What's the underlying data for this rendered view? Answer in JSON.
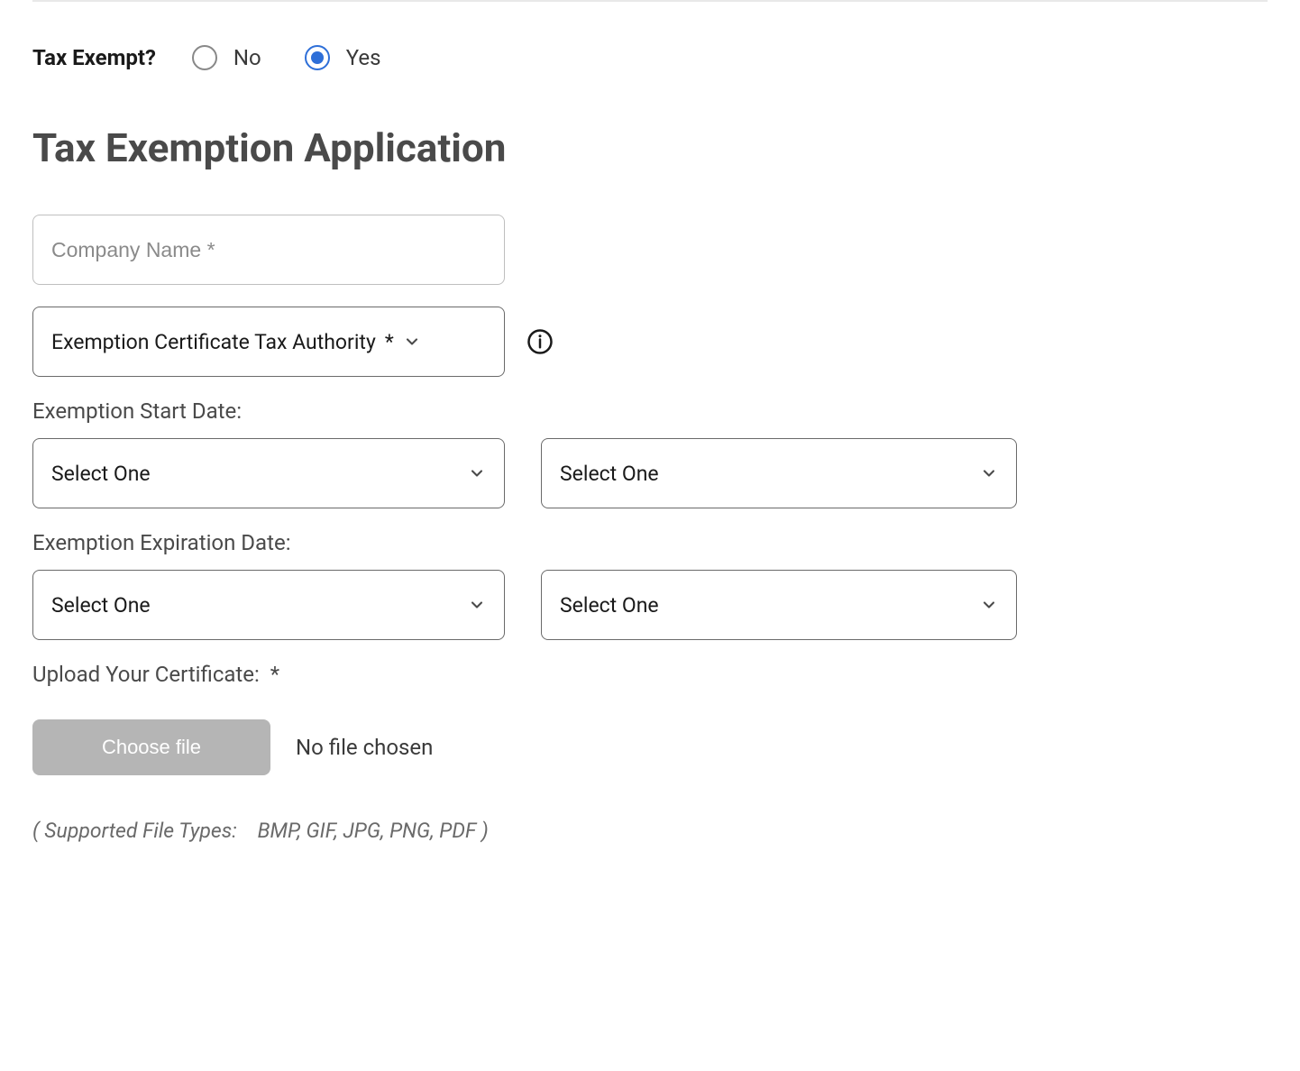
{
  "radio": {
    "question": "Tax Exempt?",
    "no_label": "No",
    "yes_label": "Yes",
    "selected": "yes"
  },
  "title": "Tax Exemption Application",
  "company_name": {
    "placeholder": "Company Name *"
  },
  "tax_authority": {
    "label": "Exemption Certificate Tax Authority",
    "required_marker": "*"
  },
  "start_date": {
    "label": "Exemption Start Date:",
    "select1": "Select One",
    "select2": "Select One"
  },
  "expiration_date": {
    "label": "Exemption Expiration Date:",
    "select1": "Select One",
    "select2": "Select One"
  },
  "upload": {
    "label": "Upload Your Certificate:",
    "required_marker": "*",
    "button": "Choose file",
    "status": "No file chosen"
  },
  "supported_types": "( Supported File Types: BMP, GIF, JPG, PNG, PDF )"
}
